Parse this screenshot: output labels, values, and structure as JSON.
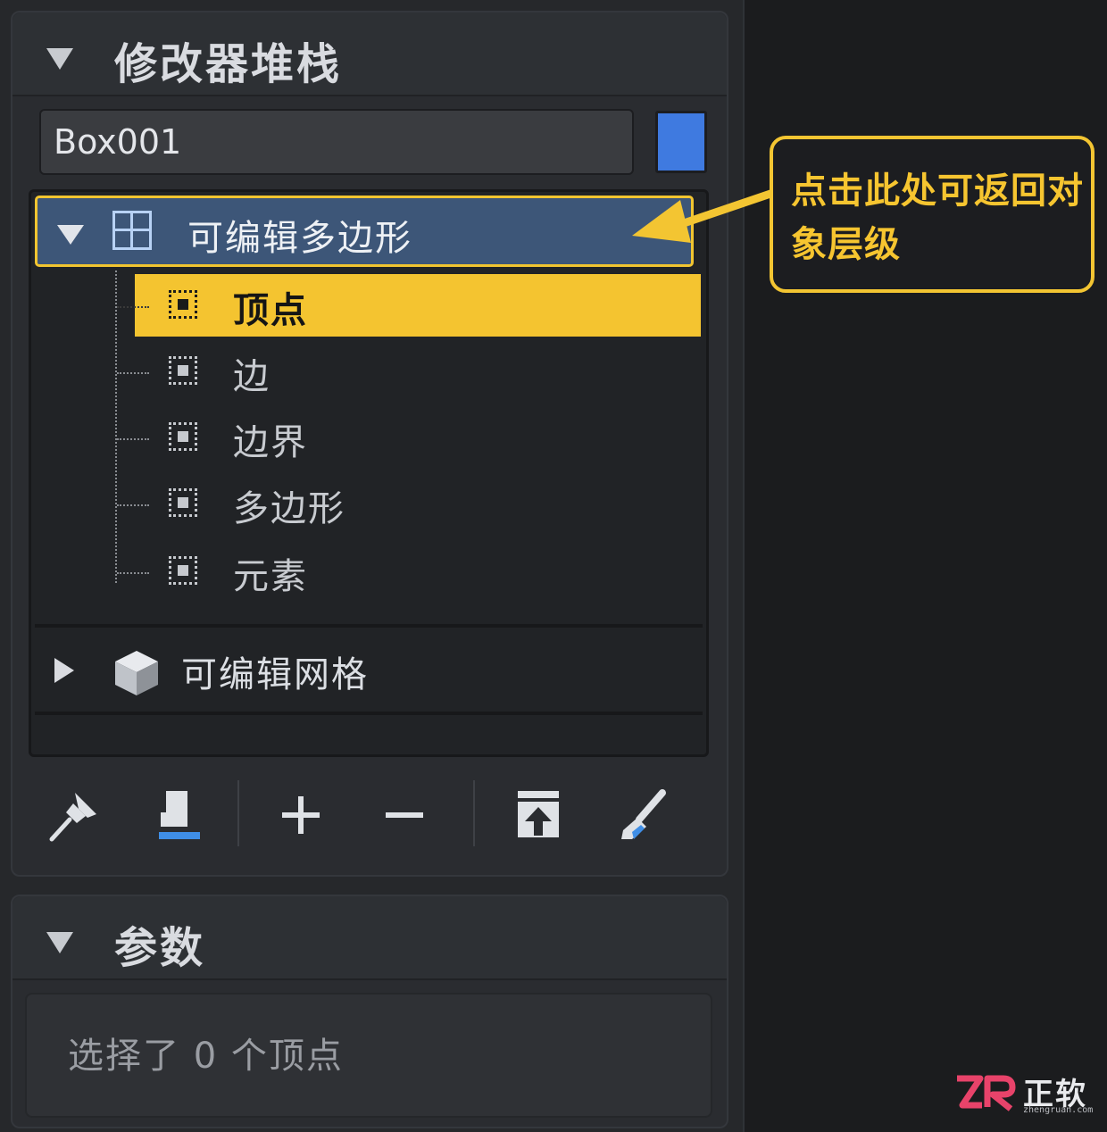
{
  "modifier_stack": {
    "title": "修改器堆栈",
    "object_name": "Box001",
    "object_color": "#3f7ae0",
    "modifiers": [
      {
        "label": "可编辑多边形",
        "icon": "grid-icon",
        "expanded": true,
        "highlighted": true,
        "sub_objects": [
          {
            "label": "顶点",
            "icon": "vertex-icon",
            "selected": true
          },
          {
            "label": "边",
            "icon": "edge-icon",
            "selected": false
          },
          {
            "label": "边界",
            "icon": "border-icon",
            "selected": false
          },
          {
            "label": "多边形",
            "icon": "polygon-icon",
            "selected": false
          },
          {
            "label": "元素",
            "icon": "element-icon",
            "selected": false
          }
        ]
      },
      {
        "label": "可编辑网格",
        "icon": "cube-icon",
        "expanded": false
      }
    ],
    "toolbar": [
      {
        "icon": "pin-icon"
      },
      {
        "icon": "show-end-result-icon"
      },
      {
        "icon": "plus-icon"
      },
      {
        "icon": "minus-icon"
      },
      {
        "icon": "collapse-stack-icon"
      },
      {
        "icon": "brush-icon"
      }
    ]
  },
  "parameters": {
    "title": "参数",
    "status_text": "选择了 0 个顶点"
  },
  "callout": {
    "text": "点击此处可返回对象层级"
  },
  "watermark": {
    "logo_letters": "ZR",
    "name": "正软",
    "url": "zhengruan.com"
  },
  "colors": {
    "accent_yellow": "#f4c430",
    "selection_blue": "#3d5678",
    "panel_bg": "#26282b"
  }
}
